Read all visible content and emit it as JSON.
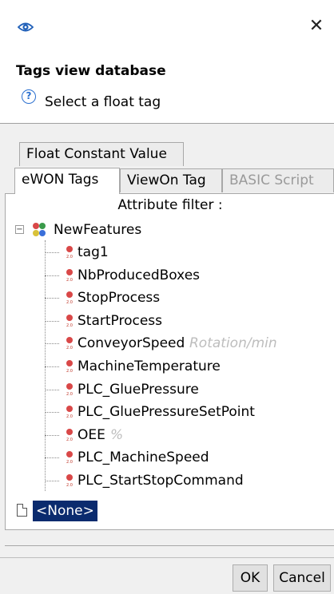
{
  "window": {
    "close_glyph": "✕"
  },
  "dialog": {
    "title": "Tags view database",
    "message": "Select a float tag"
  },
  "tabs": [
    {
      "label": "Float Constant Value",
      "state": "normal"
    },
    {
      "label": "eWON Tags",
      "state": "active"
    },
    {
      "label": "ViewOn Tag",
      "state": "normal"
    },
    {
      "label": "BASIC Script",
      "state": "disabled"
    }
  ],
  "panel": {
    "filter_label": "Attribute filter :"
  },
  "tree": {
    "root": {
      "label": "NewFeatures",
      "expanded": true,
      "expander_glyph": "−"
    },
    "items": [
      {
        "label": "tag1",
        "unit": ""
      },
      {
        "label": "NbProducedBoxes",
        "unit": ""
      },
      {
        "label": "StopProcess",
        "unit": ""
      },
      {
        "label": "StartProcess",
        "unit": ""
      },
      {
        "label": "ConveyorSpeed",
        "unit": "Rotation/min"
      },
      {
        "label": "MachineTemperature",
        "unit": ""
      },
      {
        "label": "PLC_GluePressure",
        "unit": ""
      },
      {
        "label": "PLC_GluePressureSetPoint",
        "unit": ""
      },
      {
        "label": "OEE",
        "unit": "%"
      },
      {
        "label": "PLC_MachineSpeed",
        "unit": ""
      },
      {
        "label": "PLC_StartStopCommand",
        "unit": ""
      }
    ],
    "none_item": {
      "label": "<None>",
      "selected": true
    }
  },
  "buttons": {
    "ok": "OK",
    "cancel": "Cancel"
  },
  "colors": {
    "selection": "#0b2b6e",
    "unit_text": "#bdbdbd",
    "help_icon": "#2a6fcf"
  },
  "icons": {
    "app": "eye-icon",
    "help": "question-circle-icon",
    "folder": "tag-group-icon",
    "tag": "tag-icon",
    "none": "document-icon"
  }
}
